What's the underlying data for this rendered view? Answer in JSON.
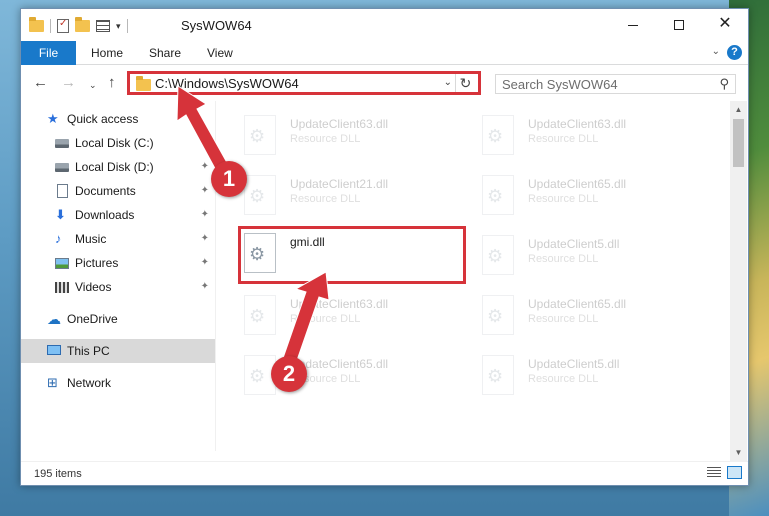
{
  "window": {
    "title": "SysWOW64",
    "minimize_glyph": "—",
    "close_glyph": "✕"
  },
  "ribbon": {
    "file": "File",
    "home": "Home",
    "share": "Share",
    "view": "View",
    "expand_glyph": "⌄",
    "help_glyph": "?"
  },
  "nav_buttons": {
    "back": "←",
    "forward": "→",
    "recent": "⌄",
    "up": "↑"
  },
  "address": {
    "path": "C:\\Windows\\SysWOW64",
    "dropdown_glyph": "⌄",
    "refresh_glyph": "↻"
  },
  "search": {
    "placeholder": "Search SysWOW64",
    "icon_glyph": "⚲"
  },
  "navpane": {
    "quick_access": "Quick access",
    "items": [
      {
        "label": "Local Disk (C:)",
        "icon": "drive-icon"
      },
      {
        "label": "Local Disk (D:)",
        "icon": "drive-icon"
      },
      {
        "label": "Documents",
        "icon": "documents-icon"
      },
      {
        "label": "Downloads",
        "icon": "downloads-icon"
      },
      {
        "label": "Music",
        "icon": "music-icon"
      },
      {
        "label": "Pictures",
        "icon": "pictures-icon"
      },
      {
        "label": "Videos",
        "icon": "videos-icon"
      }
    ],
    "pin_glyph": "📌",
    "onedrive": "OneDrive",
    "this_pc": "This PC",
    "network": "Network"
  },
  "files": [
    {
      "name": "UpdateClient63.dll",
      "type": "Resource DLL",
      "faded": true
    },
    {
      "name": "UpdateClient63.dll",
      "type": "Resource DLL",
      "faded": true
    },
    {
      "name": "UpdateClient21.dll",
      "type": "Resource DLL",
      "faded": true
    },
    {
      "name": "UpdateClient65.dll",
      "type": "Resource DLL",
      "faded": true
    },
    {
      "name": "gmi.dll",
      "type": "",
      "faded": false
    },
    {
      "name": "UpdateClient5.dll",
      "type": "Resource DLL",
      "faded": true
    },
    {
      "name": "UpdateClient63.dll",
      "type": "Resource DLL",
      "faded": true
    },
    {
      "name": "UpdateClient65.dll",
      "type": "Resource DLL",
      "faded": true
    },
    {
      "name": "UpdateClient65.dll",
      "type": "Resource DLL",
      "faded": true
    },
    {
      "name": "UpdateClient5.dll",
      "type": "Resource DLL",
      "faded": true
    }
  ],
  "status": {
    "item_count": "195 items"
  },
  "annotations": {
    "step1": "1",
    "step2": "2",
    "color": "#d6333a"
  }
}
